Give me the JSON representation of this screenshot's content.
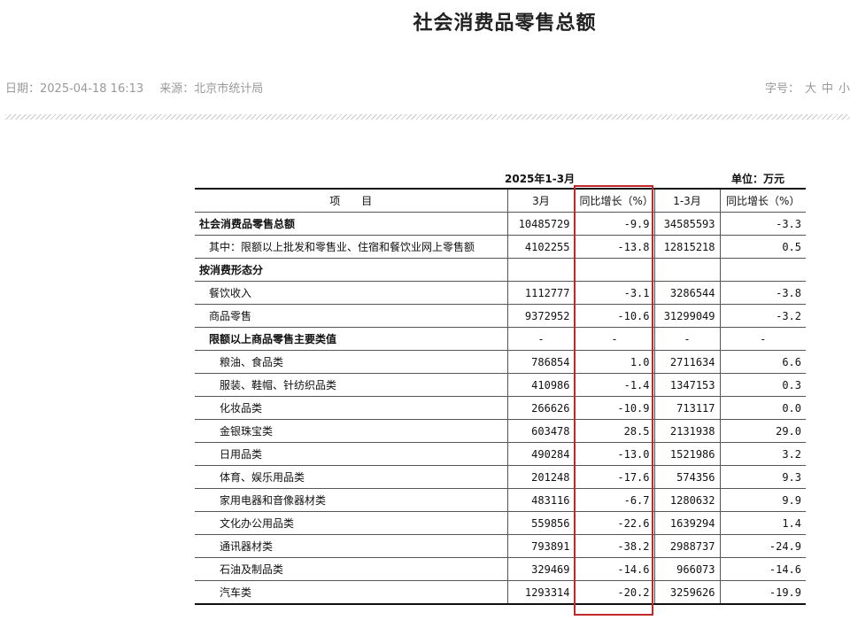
{
  "page": {
    "title": "社会消费品零售总额",
    "date": "日期：2025-04-18 16:13",
    "source": "来源：北京市统计局",
    "font_size_label": "字号：",
    "font_size_options": [
      "大",
      "中",
      "小"
    ]
  },
  "table": {
    "period": "2025年1-3月",
    "unit": "单位：万元",
    "headers": [
      "项　　目",
      "3月",
      "同比增长（%）",
      "1-3月",
      "同比增长（%）"
    ],
    "rows": [
      {
        "item": "社会消费品零售总额",
        "style": "bold",
        "mar": "10485729",
        "mar_yoy": "-9.9",
        "q1": "34585593",
        "q1_yoy": "-3.3"
      },
      {
        "item": "其中：限额以上批发和零售业、住宿和餐饮业网上零售额",
        "style": "ind1",
        "mar": "4102255",
        "mar_yoy": "-13.8",
        "q1": "12815218",
        "q1_yoy": "0.5"
      },
      {
        "item": "按消费形态分",
        "style": "bold",
        "mar": "",
        "mar_yoy": "",
        "q1": "",
        "q1_yoy": ""
      },
      {
        "item": "餐饮收入",
        "style": "ind1",
        "mar": "1112777",
        "mar_yoy": "-3.1",
        "q1": "3286544",
        "q1_yoy": "-3.8"
      },
      {
        "item": "商品零售",
        "style": "ind1",
        "mar": "9372952",
        "mar_yoy": "-10.6",
        "q1": "31299049",
        "q1_yoy": "-3.2"
      },
      {
        "item": "限额以上商品零售主要类值",
        "style": "bold ind1",
        "mar": "-",
        "mar_yoy": "-",
        "q1": "-",
        "q1_yoy": "-"
      },
      {
        "item": "粮油、食品类",
        "style": "ind2",
        "mar": "786854",
        "mar_yoy": "1.0",
        "q1": "2711634",
        "q1_yoy": "6.6"
      },
      {
        "item": "服装、鞋帽、针纺织品类",
        "style": "ind2",
        "mar": "410986",
        "mar_yoy": "-1.4",
        "q1": "1347153",
        "q1_yoy": "0.3"
      },
      {
        "item": "化妆品类",
        "style": "ind2",
        "mar": "266626",
        "mar_yoy": "-10.9",
        "q1": "713117",
        "q1_yoy": "0.0"
      },
      {
        "item": "金银珠宝类",
        "style": "ind2",
        "mar": "603478",
        "mar_yoy": "28.5",
        "q1": "2131938",
        "q1_yoy": "29.0"
      },
      {
        "item": "日用品类",
        "style": "ind2",
        "mar": "490284",
        "mar_yoy": "-13.0",
        "q1": "1521986",
        "q1_yoy": "3.2"
      },
      {
        "item": "体育、娱乐用品类",
        "style": "ind2",
        "mar": "201248",
        "mar_yoy": "-17.6",
        "q1": "574356",
        "q1_yoy": "9.3"
      },
      {
        "item": "家用电器和音像器材类",
        "style": "ind2",
        "mar": "483116",
        "mar_yoy": "-6.7",
        "q1": "1280632",
        "q1_yoy": "9.9"
      },
      {
        "item": "文化办公用品类",
        "style": "ind2",
        "mar": "559856",
        "mar_yoy": "-22.6",
        "q1": "1639294",
        "q1_yoy": "1.4"
      },
      {
        "item": "通讯器材类",
        "style": "ind2",
        "mar": "793891",
        "mar_yoy": "-38.2",
        "q1": "2988737",
        "q1_yoy": "-24.9"
      },
      {
        "item": "石油及制品类",
        "style": "ind2",
        "mar": "329469",
        "mar_yoy": "-14.6",
        "q1": "966073",
        "q1_yoy": "-14.6"
      },
      {
        "item": "汽车类",
        "style": "ind2",
        "mar": "1293314",
        "mar_yoy": "-20.2",
        "q1": "3259626",
        "q1_yoy": "-19.9"
      }
    ]
  },
  "colors": {
    "highlight_box": "#c0282a",
    "meta_text": "#999999"
  }
}
